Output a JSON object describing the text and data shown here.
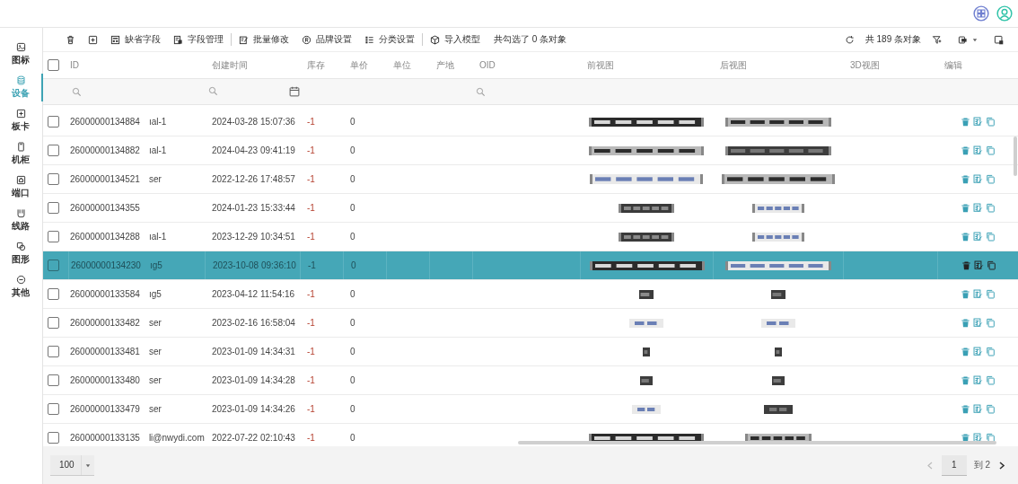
{
  "sidebar": {
    "items": [
      {
        "label": "图标",
        "selected": false
      },
      {
        "label": "设备",
        "selected": true
      },
      {
        "label": "板卡",
        "selected": false
      },
      {
        "label": "机柜",
        "selected": false
      },
      {
        "label": "端口",
        "selected": false
      },
      {
        "label": "线路",
        "selected": false
      },
      {
        "label": "图形",
        "selected": false
      },
      {
        "label": "其他",
        "selected": false
      }
    ]
  },
  "toolbar": {
    "actions": [
      {
        "label": "缺省字段"
      },
      {
        "label": "字段管理"
      },
      {
        "label": "批量修改"
      },
      {
        "label": "品牌设置"
      },
      {
        "label": "分类设置"
      },
      {
        "label": "导入模型"
      }
    ],
    "selection_info": "共勾选了 0 条对象",
    "total": "共 189 条对象"
  },
  "table": {
    "columns": [
      "ID",
      "创建时间",
      "库存",
      "单价",
      "单位",
      "产地",
      "OID",
      "前视图",
      "后视图",
      "3D视图",
      "编辑"
    ],
    "all_checked": false,
    "rows": [
      {
        "id": "26000000134884",
        "column_2": "ıal-1",
        "created": "2024-03-28 15:07:36",
        "stock": "-1",
        "price": "0",
        "selected": false,
        "checked": false
      },
      {
        "id": "26000000134882",
        "column_2": "ıal-1",
        "created": "2024-04-23 09:41:19",
        "stock": "-1",
        "price": "0",
        "selected": false,
        "checked": false
      },
      {
        "id": "26000000134521",
        "column_2": "ser",
        "created": "2022-12-26 17:48:57",
        "stock": "-1",
        "price": "0",
        "selected": false,
        "checked": false
      },
      {
        "id": "26000000134355",
        "created": "2024-01-23 15:33:44",
        "stock": "-1",
        "price": "0",
        "selected": false,
        "checked": false
      },
      {
        "id": "26000000134288",
        "column_2": "ıal-1",
        "created": "2023-12-29 10:34:51",
        "stock": "-1",
        "price": "0",
        "selected": false,
        "checked": false
      },
      {
        "id": "26000000134230",
        "column_2": "ıg5",
        "created": "2023-10-08 09:36:10",
        "stock": "-1",
        "price": "0",
        "selected": true,
        "checked": false
      },
      {
        "id": "26000000133584",
        "column_2": "ıg5",
        "created": "2023-04-12 11:54:16",
        "stock": "-1",
        "price": "0",
        "selected": false,
        "checked": false
      },
      {
        "id": "26000000133482",
        "column_2": "ser",
        "created": "2023-02-16 16:58:04",
        "stock": "-1",
        "price": "0",
        "selected": false,
        "checked": false
      },
      {
        "id": "26000000133481",
        "column_2": "ser",
        "created": "2023-01-09 14:34:31",
        "stock": "-1",
        "price": "0",
        "selected": false,
        "checked": false
      },
      {
        "id": "26000000133480",
        "column_2": "ser",
        "created": "2023-01-09 14:34:28",
        "stock": "-1",
        "price": "0",
        "selected": false,
        "checked": false
      },
      {
        "id": "26000000133479",
        "column_2": "ser",
        "created": "2023-01-09 14:34:26",
        "stock": "-1",
        "price": "0",
        "selected": false,
        "checked": false
      },
      {
        "id": "26000000133135",
        "column_2": "li@nwydi.com",
        "created": "2022-07-22 02:10:43",
        "stock": "-1",
        "price": "0",
        "selected": false,
        "checked": false
      }
    ]
  },
  "pagination": {
    "page_size": "100",
    "page": "1",
    "total_pages": "到 2"
  }
}
